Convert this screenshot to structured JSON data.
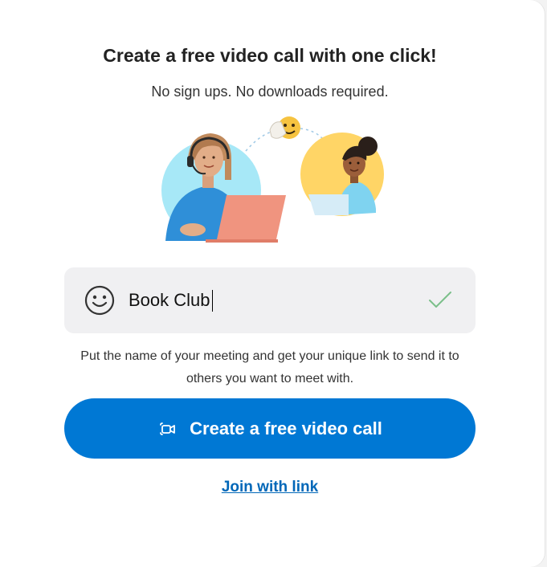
{
  "header": {
    "title": "Create a free video call with one click!",
    "subtitle": "No sign ups. No downloads required."
  },
  "illustration": {
    "description_icons": [
      "woman-with-headset-laptop",
      "waving-emoji",
      "woman-with-laptop"
    ]
  },
  "meeting_name": {
    "value": "Book Club",
    "placeholder": "",
    "emoji_icon": "smiley-icon",
    "status_icon": "checkmark-icon"
  },
  "hint": {
    "text": "Put the name of your meeting and get your unique link to send it to others you want to meet with."
  },
  "create_button": {
    "label": "Create a free video call",
    "icon": "video-camera-icon"
  },
  "join_link": {
    "label": "Join with link"
  },
  "colors": {
    "accent": "#0078d4",
    "link": "#0067b8",
    "input_bg": "#f0f0f2",
    "check": "#7bbf8a"
  }
}
